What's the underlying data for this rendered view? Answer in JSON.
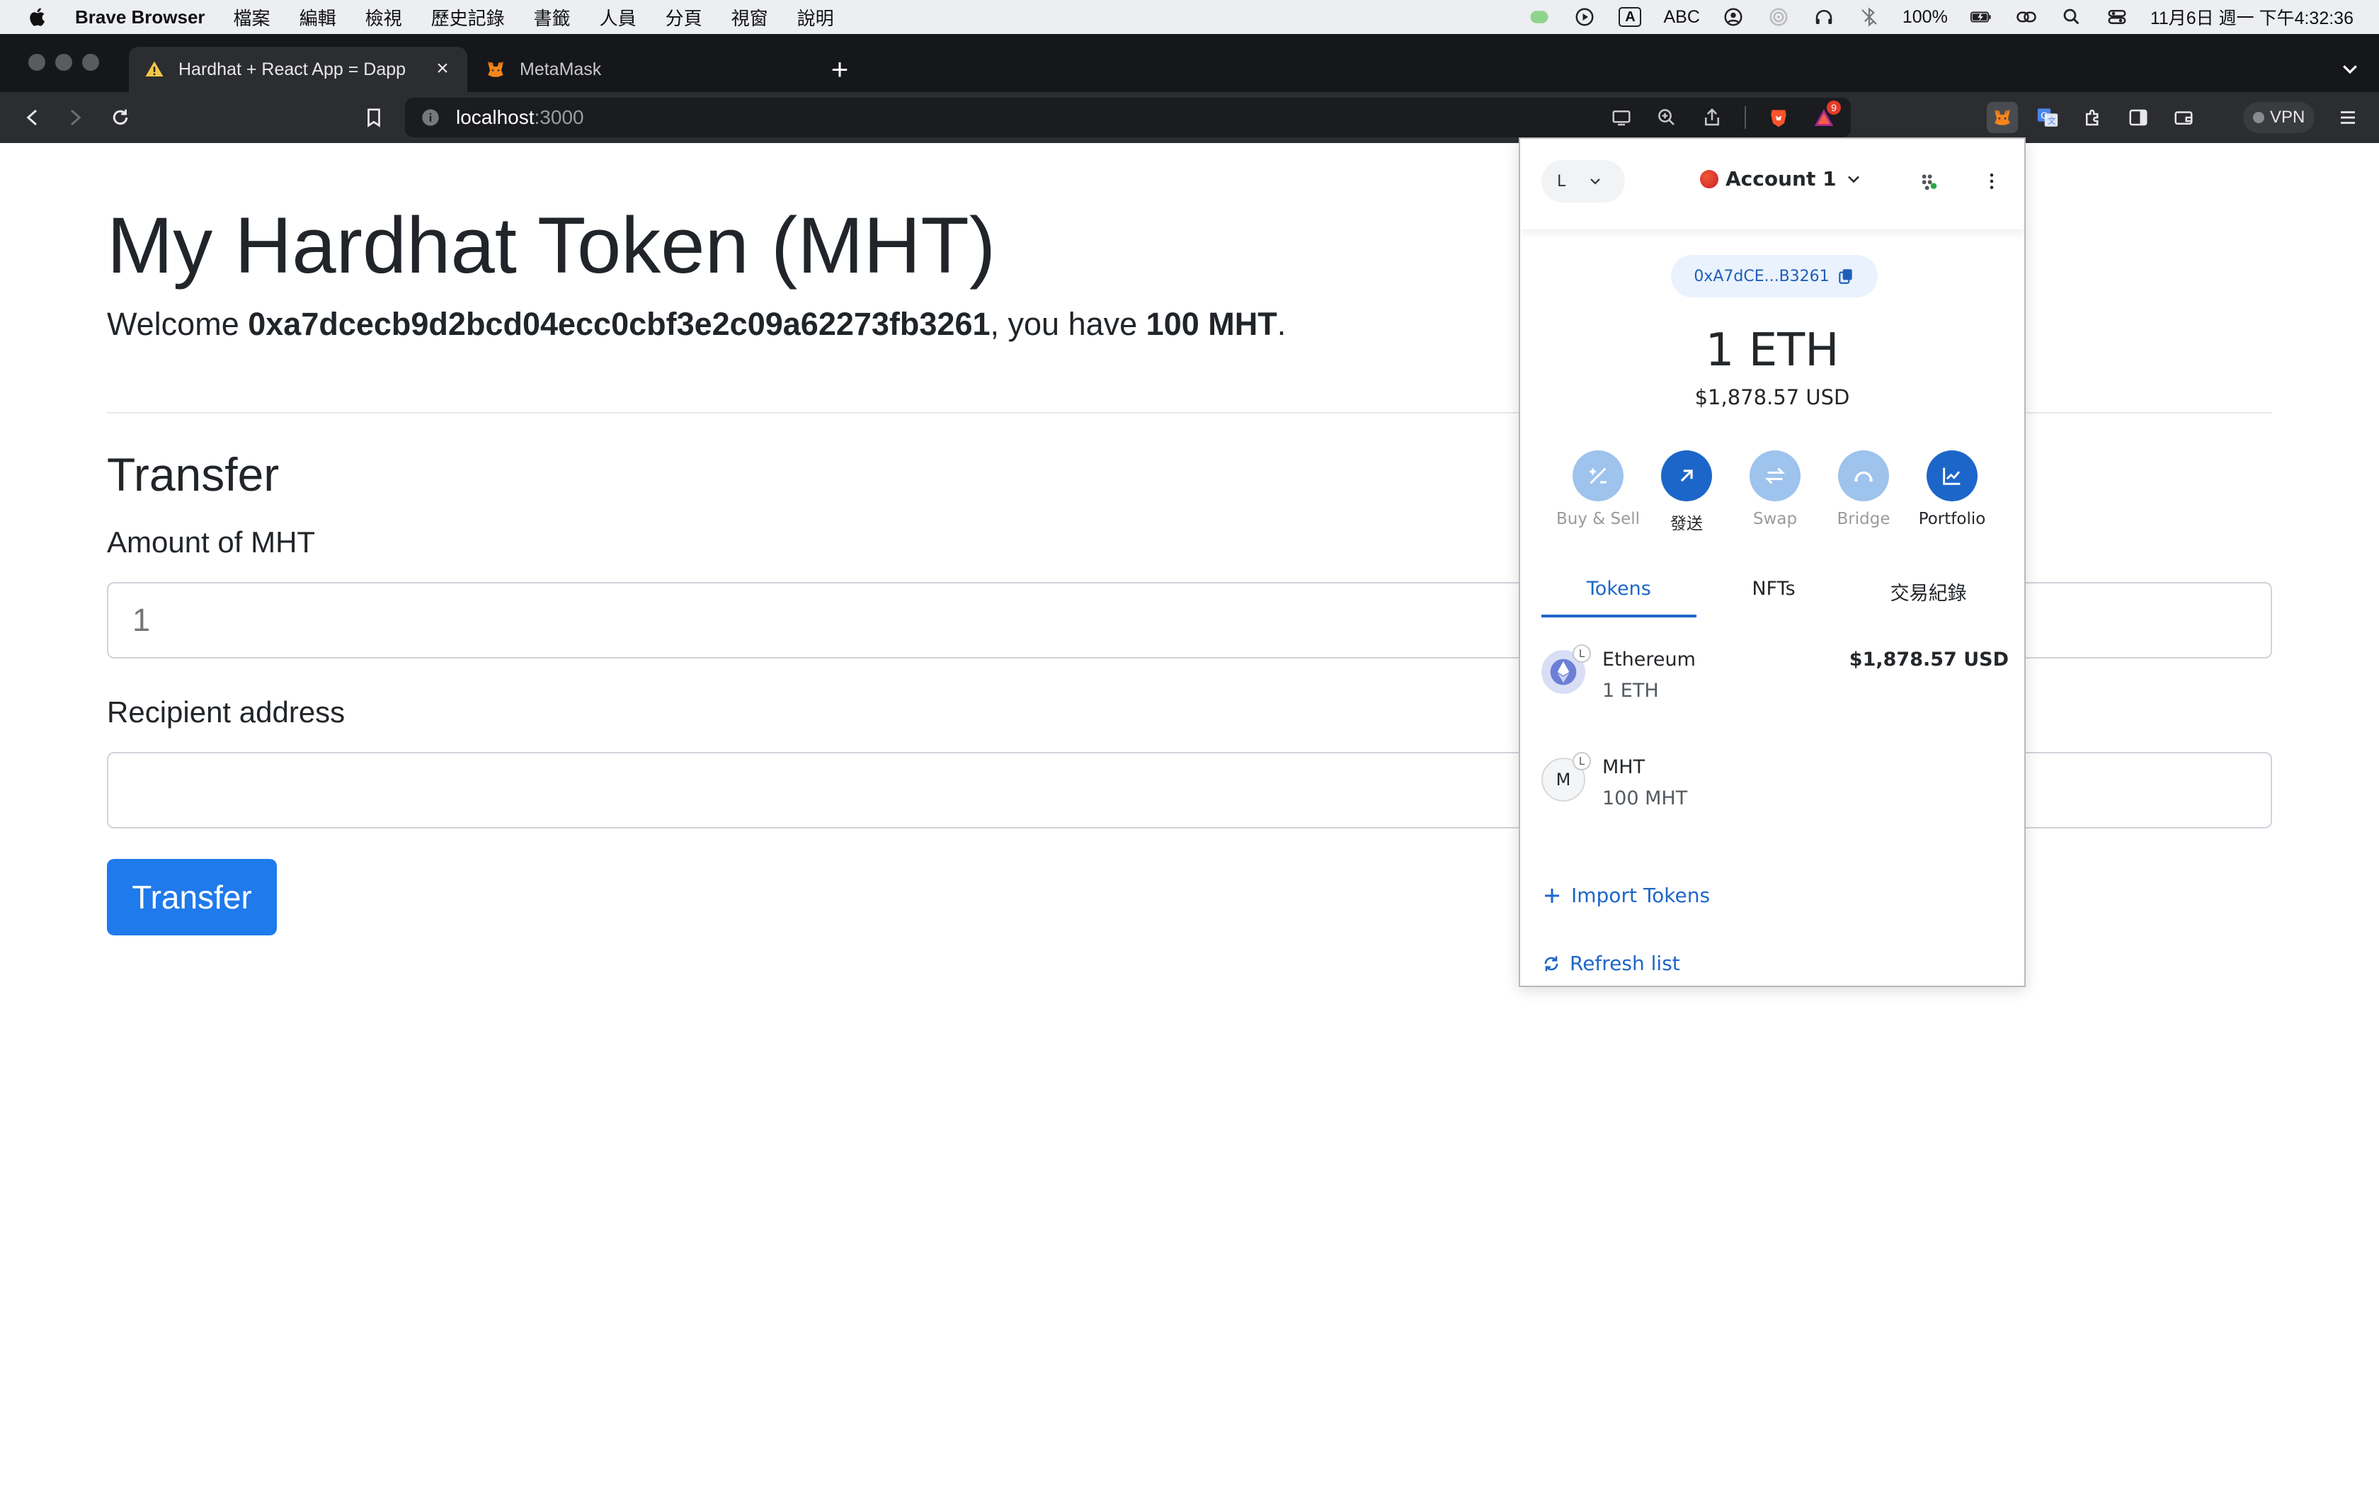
{
  "menubar": {
    "app_name": "Brave Browser",
    "items": [
      "檔案",
      "編輯",
      "檢視",
      "歷史記錄",
      "書籤",
      "人員",
      "分頁",
      "視窗",
      "說明"
    ],
    "input_source": "ABC",
    "input_glyph": "A",
    "battery": "100%",
    "datetime": "11月6日 週一 下午4:32:36"
  },
  "browser": {
    "tabs": [
      {
        "title": "Hardhat + React App = Dapp",
        "active": true
      },
      {
        "title": "MetaMask",
        "active": false
      }
    ],
    "url_host": "localhost",
    "url_port": ":3000",
    "notification_count": "9",
    "vpn_label": "VPN"
  },
  "page": {
    "title": "My Hardhat Token (MHT)",
    "welcome_prefix": "Welcome ",
    "address": "0xa7dcecb9d2bcd04ecc0cbf3e2c09a62273fb3261",
    "welcome_middle": ", you have ",
    "balance": "100 MHT",
    "welcome_suffix": ".",
    "transfer_heading": "Transfer",
    "amount_label": "Amount of MHT",
    "amount_placeholder": "1",
    "recipient_label": "Recipient address",
    "recipient_placeholder": "",
    "transfer_button": "Transfer"
  },
  "metamask": {
    "network_letter": "L",
    "account_name": "Account 1",
    "address_short": "0xA7dCE...B3261",
    "balance": "1 ETH",
    "balance_usd": "$1,878.57 USD",
    "actions": [
      {
        "label": "Buy & Sell",
        "icon": "buy-sell-icon",
        "enabled": false
      },
      {
        "label": "發送",
        "icon": "send-arrow-icon",
        "enabled": true
      },
      {
        "label": "Swap",
        "icon": "swap-icon",
        "enabled": false
      },
      {
        "label": "Bridge",
        "icon": "bridge-icon",
        "enabled": false
      },
      {
        "label": "Portfolio",
        "icon": "portfolio-chart-icon",
        "enabled": true
      }
    ],
    "tabs": [
      "Tokens",
      "NFTs",
      "交易紀錄"
    ],
    "active_tab": "Tokens",
    "tokens": [
      {
        "name": "Ethereum",
        "amount": "1 ETH",
        "value": "$1,878.57 USD",
        "badge": "L",
        "icon": "ethereum-icon"
      },
      {
        "name": "MHT",
        "amount": "100 MHT",
        "value": "",
        "badge": "L",
        "letter": "M"
      }
    ],
    "import_tokens": "Import Tokens",
    "refresh_list": "Refresh list"
  },
  "colors": {
    "primary_button": "#1f7aec",
    "metamask_blue": "#1d66c9",
    "metamask_blue_disabled": "#9ec3ec"
  }
}
